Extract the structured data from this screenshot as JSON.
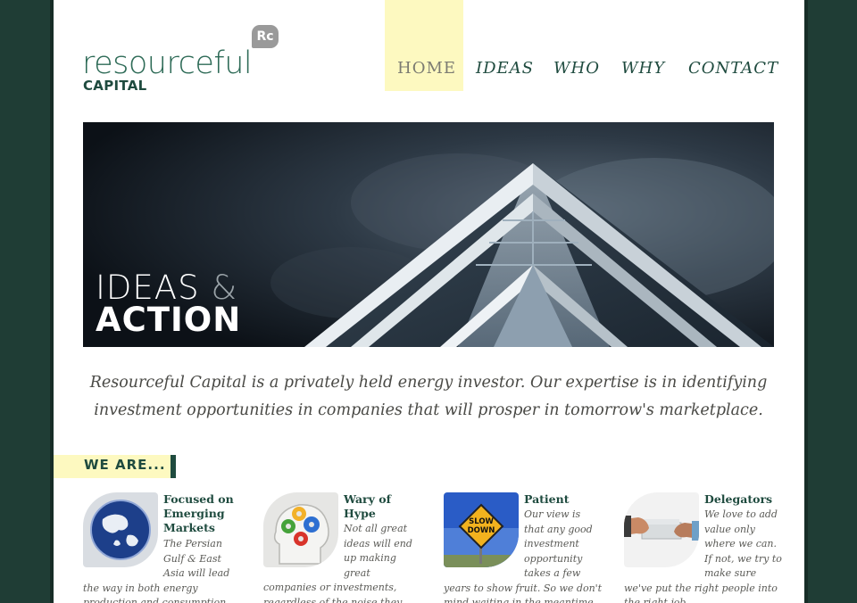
{
  "logo": {
    "word": "resourceful",
    "sub": "CAPITAL",
    "badge": "Rc"
  },
  "nav": {
    "home": "HOME",
    "ideas": "IDEAS",
    "who": "WHO",
    "why": "WHY",
    "contact": "CONTACT"
  },
  "hero": {
    "line1_word": "IDEAS",
    "line1_amp": "&",
    "line2": "ACTION"
  },
  "intro": "Resourceful Capital is a privately held energy investor. Our expertise is in identifying investment opportunities in companies that will prosper in tomorrow's marketplace.",
  "we_are": "WE ARE...",
  "features": [
    {
      "title": "Focused on Emerging Markets",
      "body": "The Persian Gulf & East Asia will lead the way in both energy production and consumption respectively."
    },
    {
      "title": "Wary of Hype",
      "body": "Not all great ideas will end up making great companies or investments, regardless of the noise they make."
    },
    {
      "title": "Patient",
      "body": "Our view is that any good investment opportunity takes a few years to show fruit. So we don't mind waiting in the meantime."
    },
    {
      "title": "Delegators",
      "body": "We love to add value only where we can. If not, we try to make sure we've put the right people into the right job."
    }
  ],
  "sign_text": "SLOW DOWN",
  "colors": {
    "brand_green": "#1f4b3f",
    "nav_highlight": "#fdf9c0",
    "background": "#1f3d35"
  }
}
